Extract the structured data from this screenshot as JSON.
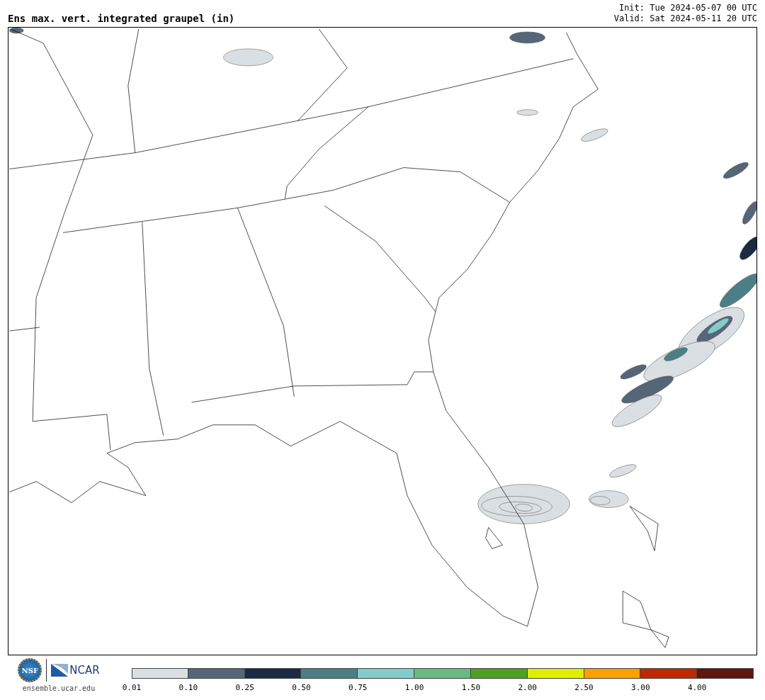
{
  "title": "Ens max. vert. integrated graupel (in)",
  "init": "Init: Tue 2024-05-07 00 UTC",
  "valid": "Valid: Sat 2024-05-11 20 UTC",
  "logos": {
    "nsf": "NSF",
    "ncar": "NCAR",
    "url": "ensemble.ucar.edu"
  },
  "legend": [
    {
      "color": "#dadfe3",
      "label": "0.01"
    },
    {
      "color": "#566679",
      "label": "0.10"
    },
    {
      "color": "#1b2a42",
      "label": "0.25"
    },
    {
      "color": "#4b7f86",
      "label": "0.50"
    },
    {
      "color": "#82cdc9",
      "label": "0.75"
    },
    {
      "color": "#67bb80",
      "label": "1.00"
    },
    {
      "color": "#4ea121",
      "label": "1.50"
    },
    {
      "color": "#dfef00",
      "label": "2.00"
    },
    {
      "color": "#fba000",
      "label": "2.50"
    },
    {
      "color": "#c02800",
      "label": "3.00"
    },
    {
      "color": "#5f160d",
      "label": "4.00"
    }
  ]
}
